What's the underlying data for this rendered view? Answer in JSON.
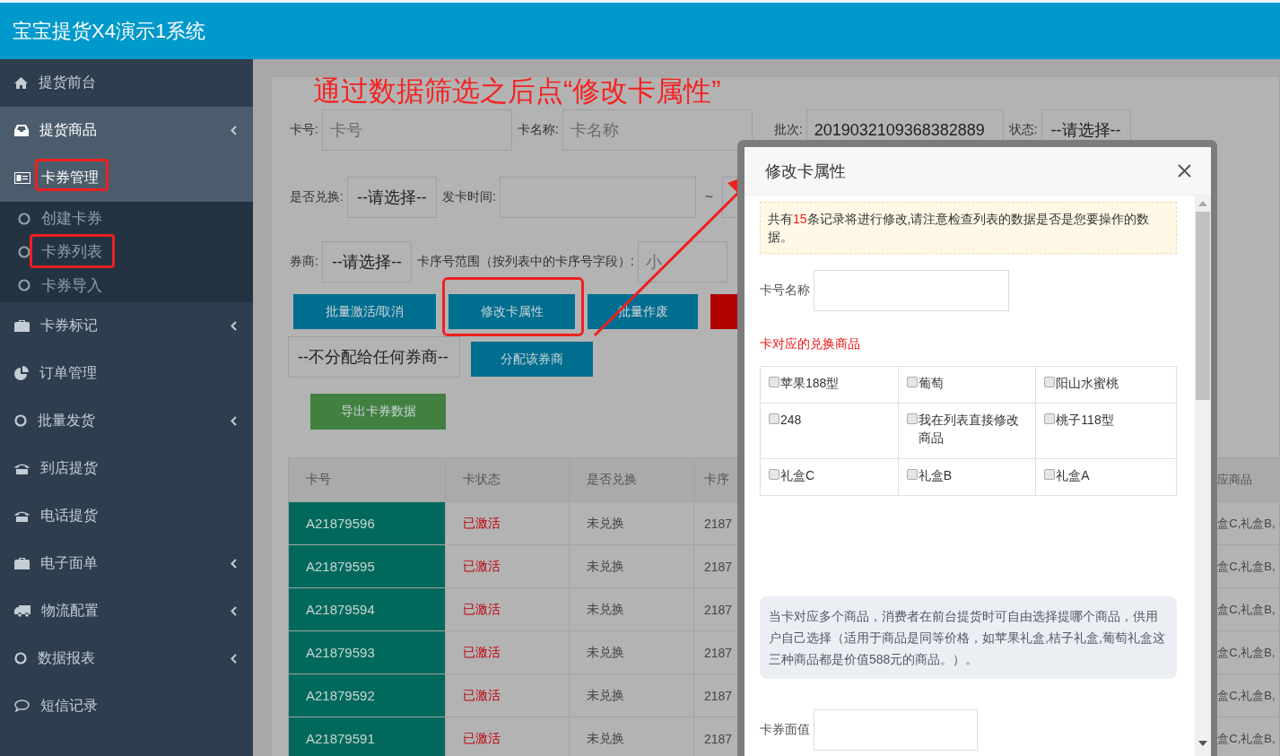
{
  "header": {
    "title": "宝宝提货X4演示1系统"
  },
  "sidebar": {
    "items": [
      {
        "label": "提货前台",
        "expandable": false,
        "highlighted": false
      },
      {
        "label": "提货商品",
        "expandable": true,
        "highlighted": true
      },
      {
        "label": "卡券管理",
        "expandable": false,
        "highlighted": true,
        "expanded": true,
        "children": [
          {
            "label": "创建卡券"
          },
          {
            "label": "卡券列表"
          },
          {
            "label": "卡券导入"
          }
        ]
      },
      {
        "label": "卡券标记",
        "expandable": true,
        "highlighted": false
      },
      {
        "label": "订单管理",
        "expandable": false,
        "highlighted": false
      },
      {
        "label": "批量发货",
        "expandable": true,
        "highlighted": false
      },
      {
        "label": "到店提货",
        "expandable": false,
        "highlighted": false
      },
      {
        "label": "电话提货",
        "expandable": false,
        "highlighted": false
      },
      {
        "label": "电子面单",
        "expandable": true,
        "highlighted": false
      },
      {
        "label": "物流配置",
        "expandable": true,
        "highlighted": false
      },
      {
        "label": "数据报表",
        "expandable": true,
        "highlighted": false
      },
      {
        "label": "短信记录",
        "expandable": false,
        "highlighted": false
      }
    ]
  },
  "annotation": {
    "text": "通过数据筛选之后点“修改卡属性”"
  },
  "filters": {
    "card_no": {
      "label": "卡号:",
      "placeholder": "卡号"
    },
    "card_name": {
      "label": "卡名称:",
      "placeholder": "卡名称"
    },
    "batch": {
      "label": "批次:",
      "value": "2019032109368382889"
    },
    "status": {
      "label": "状态:",
      "value": "--请选择--"
    },
    "exchanged": {
      "label": "是否兑换:",
      "value": "--请选择--"
    },
    "issue_time": {
      "label": "发卡时间:",
      "separator": "~"
    },
    "dealer": {
      "label": "券商:",
      "value": "--请选择--"
    },
    "serial_range": {
      "label": "卡序号范围（按列表中的卡序号字段）:",
      "placeholder": "小"
    }
  },
  "actions": [
    {
      "label": "批量激活/取消",
      "kind": "primary"
    },
    {
      "label": "修改卡属性",
      "kind": "primary"
    },
    {
      "label": "批量作废",
      "kind": "primary"
    },
    {
      "kind": "danger"
    }
  ],
  "assign": {
    "select": "--不分配给任何券商--",
    "button": "分配该券商"
  },
  "export_button": "导出卡券数据",
  "table": {
    "columns": [
      "卡号",
      "卡状态",
      "是否兑换",
      "卡序",
      "应商品"
    ],
    "rows": [
      [
        "A21879596",
        "已激活",
        "未兑换",
        "2187",
        "盒C,礼盒B,"
      ],
      [
        "A21879595",
        "已激活",
        "未兑换",
        "2187",
        "盒C,礼盒B,"
      ],
      [
        "A21879594",
        "已激活",
        "未兑换",
        "2187",
        "盒C,礼盒B,"
      ],
      [
        "A21879593",
        "已激活",
        "未兑换",
        "2187",
        "盒C,礼盒B,"
      ],
      [
        "A21879592",
        "已激活",
        "未兑换",
        "2187",
        "盒C,礼盒B,"
      ],
      [
        "A21879591",
        "已激活",
        "未兑换",
        "2187",
        "盒C,礼盒B,"
      ]
    ]
  },
  "modal": {
    "title": "修改卡属性",
    "notice": "共有**15**条记录将进行修改,请注意检查列表的数据是否是您要操作的数据。",
    "name_field": {
      "label": "卡号名称"
    },
    "products_label": "卡对应的兑换商品",
    "products": [
      {
        "label": "苹果188型",
        "checked": false
      },
      {
        "label": "葡萄",
        "checked": false
      },
      {
        "label": "阳山水蜜桃",
        "checked": false
      },
      {
        "label": "248",
        "checked": false
      },
      {
        "label": "我在列表直接修改商品",
        "checked": false
      },
      {
        "label": "桃子118型",
        "checked": false
      },
      {
        "label": "礼盒C",
        "checked": false
      },
      {
        "label": "礼盒B",
        "checked": false
      },
      {
        "label": "礼盒A",
        "checked": false
      }
    ],
    "info": "当卡对应多个商品，消费者在前台提货时可自由选择提哪个商品，供用户自己选择（适用于商品是同等价格，如苹果礼盒,桔子礼盒,葡萄礼盒这三种商品都是价值588元的商品。）。",
    "value_field": {
      "label": "卡券面值"
    }
  }
}
